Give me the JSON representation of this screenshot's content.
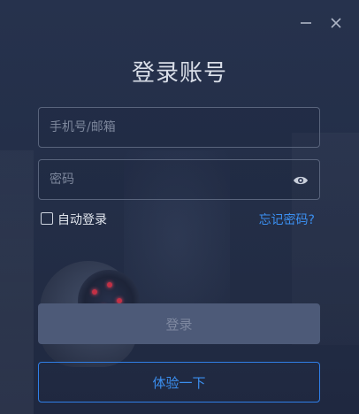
{
  "window": {
    "title": "登录账号",
    "controls": [
      {
        "icon": "minimize-icon"
      },
      {
        "icon": "close-icon"
      }
    ]
  },
  "form": {
    "account_placeholder": "手机号/邮箱",
    "password_placeholder": "密码",
    "account_value": "",
    "password_value": "",
    "show_password_icon": "eye-icon",
    "auto_login_label": "自动登录",
    "auto_login_checked": false,
    "forgot_password_label": "忘记密码?"
  },
  "actions": {
    "login_label": "登录",
    "try_label": "体验一下"
  },
  "colors": {
    "background": "#242f49",
    "accent": "#3b8ff0",
    "login_button": "#4d5a78",
    "field_border": "#59647c"
  }
}
